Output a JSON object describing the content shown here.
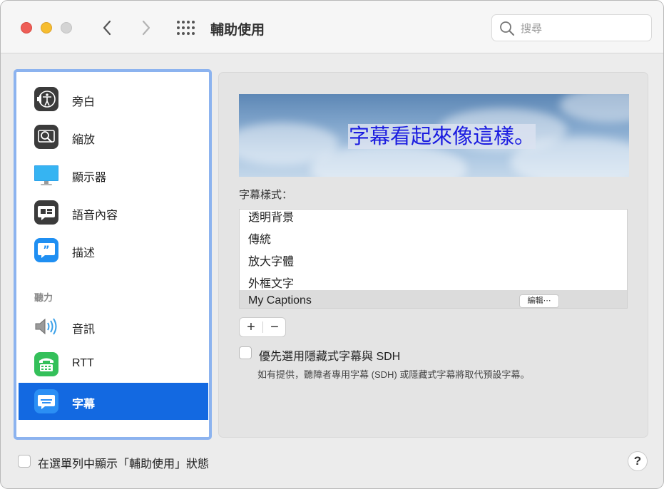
{
  "window": {
    "title": "輔助使用",
    "search_placeholder": "搜尋"
  },
  "sidebar": {
    "items": [
      {
        "label": "旁白",
        "icon": "voiceover-icon"
      },
      {
        "label": "縮放",
        "icon": "zoom-icon"
      },
      {
        "label": "顯示器",
        "icon": "display-icon"
      },
      {
        "label": "語音內容",
        "icon": "spoken-content-icon"
      },
      {
        "label": "描述",
        "icon": "descriptions-icon"
      },
      {
        "label": "音訊",
        "icon": "audio-speaker-icon"
      },
      {
        "label": "RTT",
        "icon": "rtt-icon"
      },
      {
        "label": "字幕",
        "icon": "captions-icon"
      }
    ],
    "section_hearing": "聽力",
    "selected_label": "字幕"
  },
  "captions": {
    "preview_text": "字幕看起來像這樣。",
    "styles_label": "字幕樣式：",
    "styles": [
      "透明背景",
      "傳統",
      "放大字體",
      "外框文字",
      "My Captions"
    ],
    "selected_style": "My Captions",
    "edit_button": "編輯⋯",
    "add_button": "+",
    "remove_button": "−",
    "prefer_sdh_label": "優先選用隱藏式字幕與 SDH",
    "prefer_sdh_checked": false,
    "prefer_sdh_desc": "如有提供，聽障者專用字幕 (SDH) 或隱藏式字幕將取代預設字幕。"
  },
  "footer": {
    "menu_bar_status_label": "在選單列中顯示「輔助使用」狀態",
    "menu_bar_status_checked": false,
    "help_label": "?"
  },
  "colors": {
    "accent": "#1369e1",
    "sidebar_focus_ring": "#8cb3ef",
    "caption_text": "#1b1ce0"
  }
}
